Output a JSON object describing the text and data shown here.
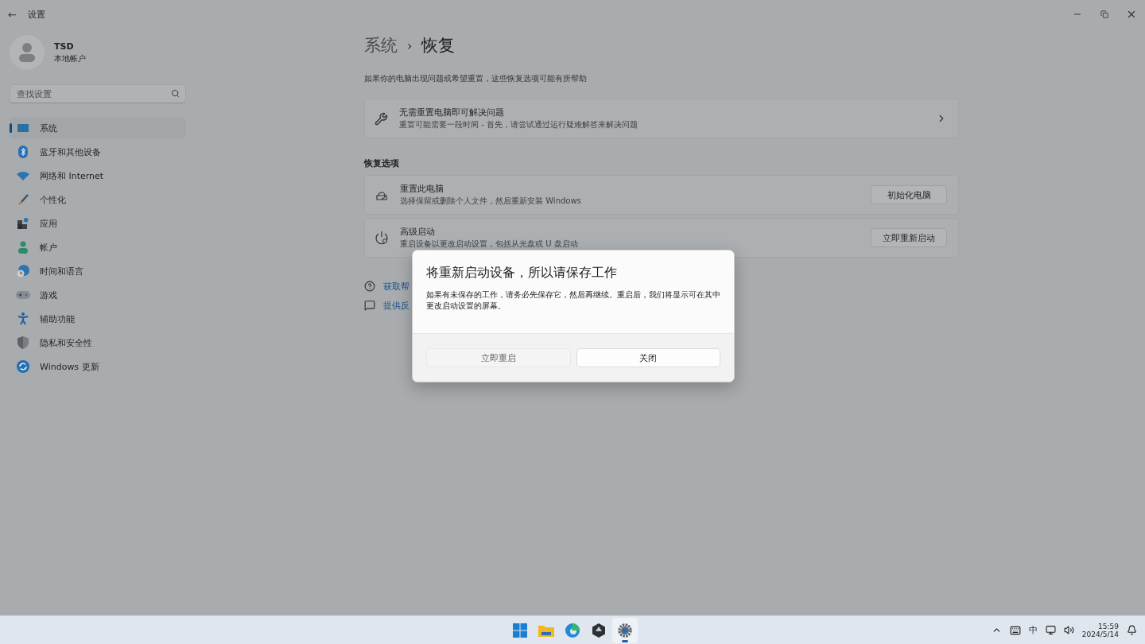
{
  "window": {
    "back": "←",
    "title": "设置"
  },
  "user": {
    "name": "TSD",
    "account": "本地帐户"
  },
  "search": {
    "placeholder": "查找设置"
  },
  "sidebar": {
    "items": [
      {
        "label": "系统",
        "selected": true
      },
      {
        "label": "蓝牙和其他设备",
        "selected": false
      },
      {
        "label": "网络和 Internet",
        "selected": false
      },
      {
        "label": "个性化",
        "selected": false
      },
      {
        "label": "应用",
        "selected": false
      },
      {
        "label": "帐户",
        "selected": false
      },
      {
        "label": "时间和语言",
        "selected": false
      },
      {
        "label": "游戏",
        "selected": false
      },
      {
        "label": "辅助功能",
        "selected": false
      },
      {
        "label": "隐私和安全性",
        "selected": false
      },
      {
        "label": "Windows 更新",
        "selected": false
      }
    ]
  },
  "breadcrumb": {
    "parent": "系统",
    "separator": "›",
    "current": "恢复"
  },
  "intro": "如果你的电脑出现问题或希望重置，这些恢复选项可能有所帮助",
  "fix_card": {
    "title": "无需重置电脑即可解决问题",
    "subtitle": "重置可能需要一段时间 - 首先，请尝试通过运行疑难解答来解决问题"
  },
  "section_title": "恢复选项",
  "options": [
    {
      "title": "重置此电脑",
      "subtitle": "选择保留或删除个人文件，然后重新安装 Windows",
      "button": "初始化电脑"
    },
    {
      "title": "高级启动",
      "subtitle": "重启设备以更改启动设置，包括从光盘或 U 盘启动",
      "button": "立即重新启动"
    }
  ],
  "links": [
    {
      "label": "获取帮"
    },
    {
      "label": "提供反"
    }
  ],
  "dialog": {
    "title": "将重新启动设备，所以请保存工作",
    "body": "如果有未保存的工作，请务必先保存它，然后再继续。重启后，我们将显示可在其中更改启动设置的屏幕。",
    "buttons": [
      {
        "label": "立即重启",
        "hovered": true
      },
      {
        "label": "关闭",
        "hovered": false
      }
    ]
  },
  "taskbar": {
    "apps": [
      {
        "selected": false
      },
      {
        "selected": false
      },
      {
        "selected": false
      },
      {
        "selected": false
      },
      {
        "selected": true
      }
    ],
    "tray": {
      "ime": "中",
      "time": "15:59",
      "date": "2024/5/14"
    }
  }
}
